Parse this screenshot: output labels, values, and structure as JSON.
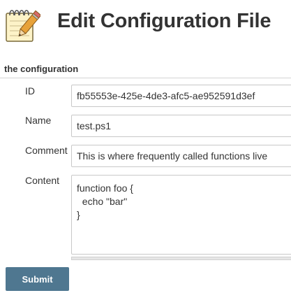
{
  "header": {
    "title": "Edit Configuration File",
    "icon": "notepad-pencil-icon"
  },
  "section": {
    "title": "the configuration"
  },
  "form": {
    "id": {
      "label": "ID",
      "value": "fb55553e-425e-4de3-afc5-ae952591d3ef"
    },
    "name": {
      "label": "Name",
      "value": "test.ps1"
    },
    "comment": {
      "label": "Comment",
      "value": "This is where frequently called functions live"
    },
    "content": {
      "label": "Content",
      "value": "function foo {\n  echo \"bar\"\n}"
    }
  },
  "actions": {
    "submit_label": "Submit"
  },
  "colors": {
    "submit_bg": "#4f7790",
    "border": "#c8c8c8",
    "text": "#333333"
  }
}
